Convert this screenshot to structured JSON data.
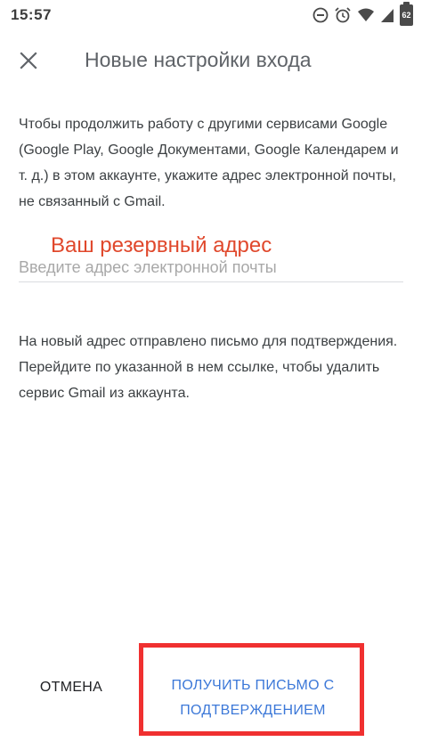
{
  "status_bar": {
    "time": "15:57",
    "battery_level": "62",
    "icons": [
      "minus-circle-icon",
      "alarm-icon",
      "wifi-icon",
      "signal-icon",
      "battery-icon"
    ]
  },
  "header": {
    "close_icon": "close-icon",
    "title": "Новые настройки входа"
  },
  "intro": {
    "text": "Чтобы продолжить работу с другими сервисами Google (Google Play, Google Документами, Google Календарем и т. д.) в этом аккаунте, укажите адрес электронной почты, не связанный с Gmail."
  },
  "email": {
    "label": "Ваш резервный адрес",
    "placeholder": "Введите адрес электронной почты",
    "value": ""
  },
  "info": {
    "text": "На новый адрес отправлено письмо для подтверждения. Перейдите по указанной в нем ссылке, чтобы удалить сервис Gmail из аккаунта."
  },
  "actions": {
    "cancel_label": "ОТМЕНА",
    "confirm_label_line1": "ПОЛУЧИТЬ ПИСЬМО С",
    "confirm_label_line2": "ПОДТВЕРЖДЕНИЕМ"
  },
  "colors": {
    "accent": "#3c78d8",
    "highlight": "#f03030",
    "annotation": "#e0482c"
  }
}
